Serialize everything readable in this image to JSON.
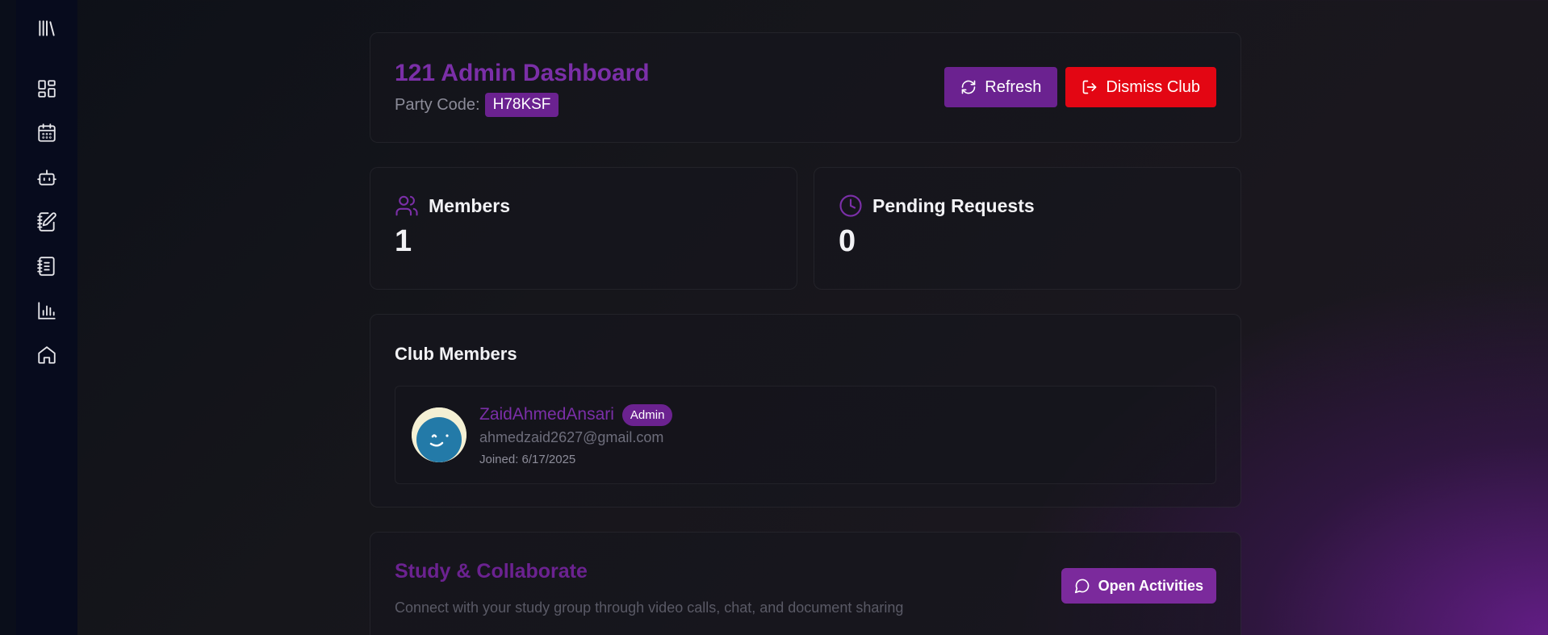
{
  "sidebar": {
    "logo_icon": "library-icon",
    "items": [
      {
        "name": "dashboard",
        "icon": "layout-dashboard-icon"
      },
      {
        "name": "calendar",
        "icon": "calendar-icon"
      },
      {
        "name": "bot",
        "icon": "bot-icon"
      },
      {
        "name": "notes-edit",
        "icon": "notebook-pen-icon"
      },
      {
        "name": "notebook",
        "icon": "notebook-text-icon"
      },
      {
        "name": "analytics",
        "icon": "bar-chart-icon"
      },
      {
        "name": "home",
        "icon": "home-icon"
      }
    ]
  },
  "header": {
    "title": "121 Admin Dashboard",
    "party_code_label": "Party Code:",
    "party_code": "H78KSF",
    "refresh_label": "Refresh",
    "dismiss_label": "Dismiss Club"
  },
  "stats": {
    "members_label": "Members",
    "members_value": "1",
    "pending_label": "Pending Requests",
    "pending_value": "0"
  },
  "club_members": {
    "title": "Club Members",
    "members": [
      {
        "name": "ZaidAhmedAnsari",
        "role": "Admin",
        "email": "ahmedzaid2627@gmail.com",
        "joined": "Joined: 6/17/2025"
      }
    ]
  },
  "study": {
    "title": "Study & Collaborate",
    "description": "Connect with your study group through video calls, chat, and document sharing",
    "button_label": "Open Activities"
  },
  "colors": {
    "accent_purple": "#6b2290",
    "danger_red": "#e30613",
    "sidebar_bg": "#070b1d"
  }
}
